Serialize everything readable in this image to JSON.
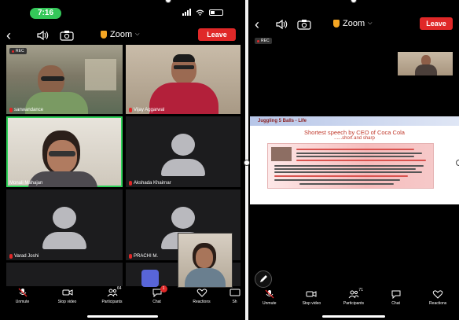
{
  "left": {
    "status": {
      "time": "7:16"
    },
    "header": {
      "title": "Zoom",
      "leave_label": "Leave"
    },
    "participants": [
      {
        "name": "sanwandance"
      },
      {
        "name": "Vijay Aggarwal"
      },
      {
        "name": "Monali Mahajan"
      },
      {
        "name": "Akshada Khairnar"
      },
      {
        "name": "Varad Joshi"
      },
      {
        "name": "PRACHI M."
      }
    ],
    "rec_label": "REC",
    "toolbar": {
      "unmute": "Unmute",
      "stop_video": "Stop video",
      "participants": "Participants",
      "participants_count": "64",
      "chat": "Chat",
      "chat_badge": "1",
      "reactions": "Reactions",
      "share": "Sh"
    }
  },
  "right": {
    "header": {
      "title": "Zoom",
      "leave_label": "Leave"
    },
    "rec_label": "REC",
    "shared_content": {
      "header_text": "Juggling 5 Balls - Life",
      "title_line1": "Shortest speech by CEO of Coca Cola",
      "title_line2": "......short and sharp"
    },
    "toolbar": {
      "unmute": "Unmute",
      "stop_video": "Stop video",
      "participants": "Participants",
      "participants_count": "71",
      "chat": "Chat",
      "reactions": "Reactions"
    }
  },
  "colors": {
    "leave": "#e02828",
    "active_speaker": "#2fd15a",
    "time_pill": "#34c759",
    "zoom_shield": "#f5a623"
  }
}
